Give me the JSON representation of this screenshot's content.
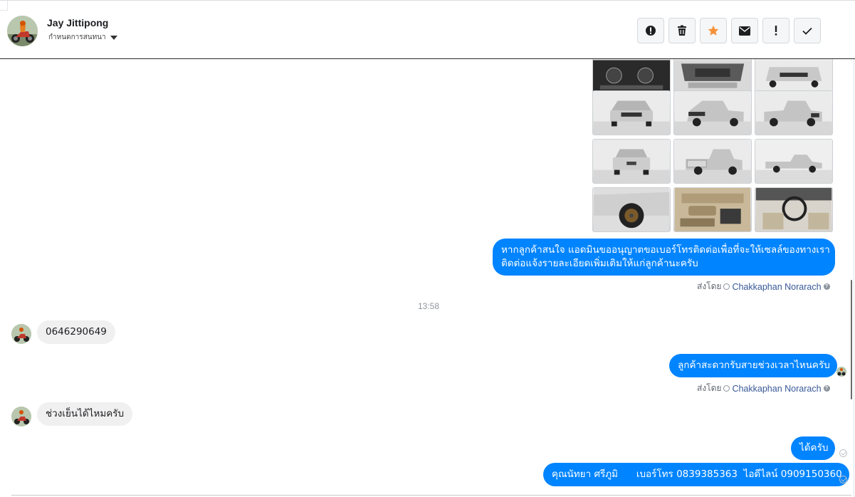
{
  "header": {
    "contact_name": "Jay Jittipong",
    "conversation_status": "กำหนดการสนทนา",
    "actions": [
      {
        "name": "mark-spam-button",
        "icon": "alert-circle-icon"
      },
      {
        "name": "delete-button",
        "icon": "trash-icon"
      },
      {
        "name": "star-button",
        "icon": "star-icon",
        "color": "#f7923a"
      },
      {
        "name": "mark-unread-button",
        "icon": "envelope-icon"
      },
      {
        "name": "follow-up-button",
        "icon": "exclamation-icon"
      },
      {
        "name": "mark-done-button",
        "icon": "check-icon"
      }
    ]
  },
  "photos": [
    "dashboard-photo",
    "engine-bay-photo",
    "truck-front-angle-photo",
    "truck-front-photo",
    "truck-front-three-quarter-photo",
    "truck-rear-three-quarter-photo",
    "truck-rear-photo",
    "truck-rear-angle-photo",
    "truck-side-photo",
    "wheel-closeup-photo",
    "door-panel-photo",
    "interior-photo"
  ],
  "messages": {
    "out_1_line1": "หากลูกค้าสนใจ แอดมินขออนุญาตขอเบอร์โทรติดต่อเพื่อที่จะให้เซลล์ของทางเรา",
    "out_1_line2": "ติดต่อแจ้งรายละเอียดเพิ่มเติมให้แก่ลูกค้านะครับ",
    "sent_by_label": "ส่งโดย",
    "agent_name": "Chakkaphan Norarach",
    "timestamp": "13:58",
    "in_1": "0646290649",
    "out_2": "ลูกค้าสะดวกรับสายช่วงเวลาไหนครับ",
    "in_2": "ช่วงเย็นได้ไหมครับ",
    "out_3": "ได้ครับ",
    "out_4": "คุณนัทยา ศรีภูมิ      เบอร์โทร 0839385363  ไอดีไลน์ 0909150360"
  },
  "colors": {
    "accent": "#0084ff",
    "incoming_bubble": "#f1f0f0",
    "star": "#f7923a",
    "agent_link": "#385898"
  }
}
